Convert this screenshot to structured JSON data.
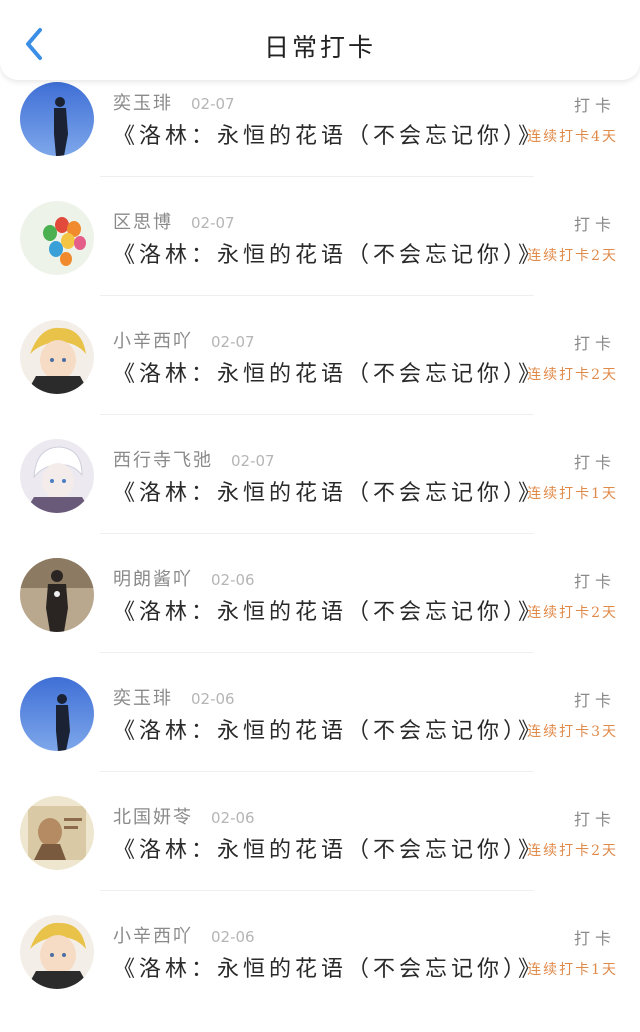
{
  "header": {
    "title": "日常打卡",
    "back_icon": "chevron-left-icon",
    "accent": "#3a8ee6"
  },
  "checkin_label": "打卡",
  "entries": [
    {
      "name": "奕玉琲",
      "date": "02-07",
      "content": "《洛林：永恒的花语（不会忘记你）》",
      "streak": "连续打卡4天",
      "avatar": "blue-sky-silhouette"
    },
    {
      "name": "区思博",
      "date": "02-07",
      "content": "《洛林：永恒的花语（不会忘记你）》",
      "streak": "连续打卡2天",
      "avatar": "colorful-balloons"
    },
    {
      "name": "小辛西吖",
      "date": "02-07",
      "content": "《洛林：永恒的花语（不会忘记你）》",
      "streak": "连续打卡2天",
      "avatar": "anime-blonde-boy"
    },
    {
      "name": "西行寺飞弛",
      "date": "02-07",
      "content": "《洛林：永恒的花语（不会忘记你）》",
      "streak": "连续打卡1天",
      "avatar": "anime-white-hair"
    },
    {
      "name": "明朗酱吖",
      "date": "02-06",
      "content": "《洛林：永恒的花语（不会忘记你）》",
      "streak": "连续打卡2天",
      "avatar": "street-figure"
    },
    {
      "name": "奕玉琲",
      "date": "02-06",
      "content": "《洛林：永恒的花语（不会忘记你）》",
      "streak": "连续打卡3天",
      "avatar": "blue-sky-silhouette"
    },
    {
      "name": "北国妍苓",
      "date": "02-06",
      "content": "《洛林：永恒的花语（不会忘记你）》",
      "streak": "连续打卡2天",
      "avatar": "sepia-portrait"
    },
    {
      "name": "小辛西吖",
      "date": "02-06",
      "content": "《洛林：永恒的花语（不会忘记你）》",
      "streak": "连续打卡1天",
      "avatar": "anime-blonde-boy"
    }
  ],
  "colors": {
    "streak": "#e08a4a",
    "name": "#8a8a8a",
    "date": "#b5b5b5"
  }
}
